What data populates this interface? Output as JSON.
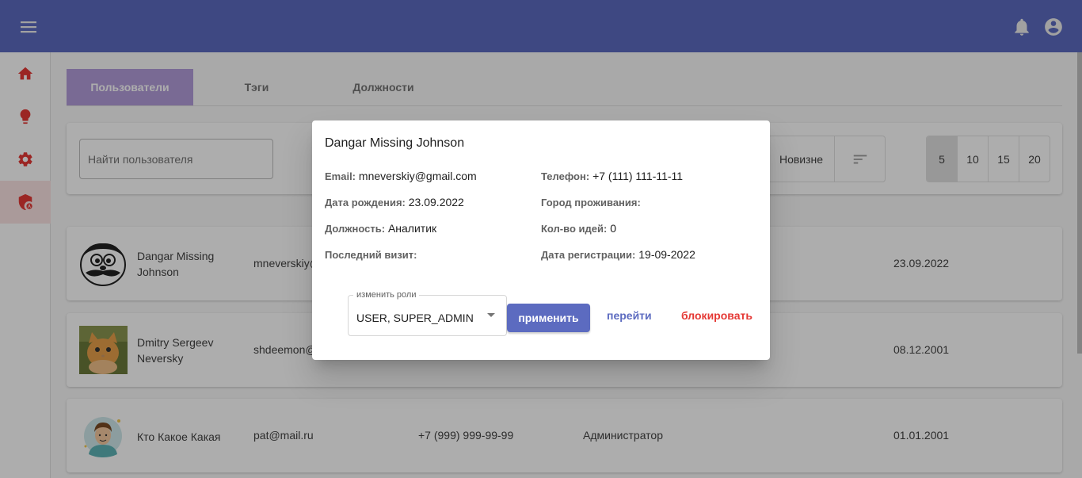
{
  "colors": {
    "primary": "#5c6bc0",
    "tab_active": "#b39ddb",
    "sidebar_icon": "#e53935",
    "danger": "#e53935"
  },
  "topbar": {
    "menu_icon": "menu-icon",
    "notifications_icon": "bell-icon",
    "account_icon": "account-circle-icon"
  },
  "sidebar": {
    "items": [
      {
        "icon": "home-icon"
      },
      {
        "icon": "lightbulb-icon"
      },
      {
        "icon": "gear-icon"
      },
      {
        "icon": "admin-shield-icon",
        "active": true
      }
    ]
  },
  "tabs": [
    {
      "label": "Пользователи",
      "active": true
    },
    {
      "label": "Тэги"
    },
    {
      "label": "Должности"
    }
  ],
  "filters": {
    "search_placeholder": "Найти пользователя",
    "sort_label": "Новизне",
    "sort_icon": "sort-icon",
    "page_sizes": [
      "5",
      "10",
      "15",
      "20"
    ],
    "page_size_selected": "5"
  },
  "users": [
    {
      "name": "Dangar Missing Johnson",
      "email": "mneverskiy@gmail.com",
      "phone": "",
      "role": "",
      "date": "23.09.2022",
      "avatar": "mustache-face-avatar"
    },
    {
      "name": "Dmitry Sergeev Neversky",
      "email": "shdeemon@",
      "phone": "",
      "role": "",
      "date": "08.12.2001",
      "avatar": "cat-photo-avatar"
    },
    {
      "name": "Кто Какое Какая",
      "email": "pat@mail.ru",
      "phone": "+7 (999) 999-99-99",
      "role": "Администратор",
      "date": "01.01.2001",
      "avatar": "cartoon-man-avatar"
    }
  ],
  "dialog": {
    "title": "Dangar Missing Johnson",
    "email_label": "Email:",
    "email": "mneverskiy@gmail.com",
    "phone_label": "Телефон:",
    "phone": "+7 (111) 111-11-11",
    "birth_label": "Дата рождения:",
    "birth": "23.09.2022",
    "city_label": "Город проживания:",
    "city": "",
    "position_label": "Должность:",
    "position": "Аналитик",
    "ideas_label": "Кол-во идей:",
    "ideas": "0",
    "last_visit_label": "Последний визит:",
    "last_visit": "",
    "registered_label": "Дата регистрации:",
    "registered": "19-09-2022",
    "roles_legend": "изменить роли",
    "roles_value": "USER, SUPER_ADMIN",
    "apply_label": "применить",
    "goto_label": "перейти",
    "block_label": "блокировать"
  }
}
